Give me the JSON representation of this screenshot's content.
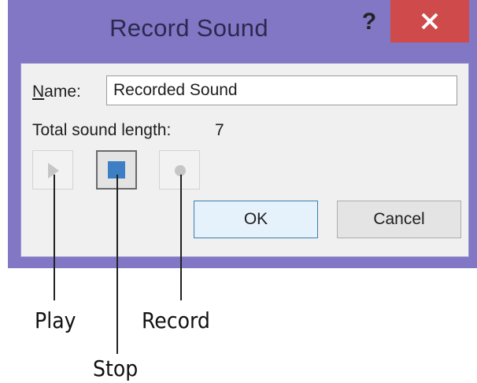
{
  "dialog": {
    "title": "Record Sound",
    "help_label": "?",
    "name_label_accesskey": "N",
    "name_label_rest": "ame:",
    "name_value": "Recorded Sound",
    "length_label": "Total sound length:",
    "length_value": "7",
    "ok_label": "OK",
    "cancel_label": "Cancel"
  },
  "callouts": {
    "play": "Play",
    "stop": "Stop",
    "record": "Record"
  },
  "colors": {
    "window_frame": "#8177c4",
    "close_button": "#cf4a4a",
    "stop_icon": "#3d7ec4",
    "disabled_icon": "#c6c6c6"
  },
  "icons": {
    "play": "play-icon",
    "stop": "stop-icon",
    "record": "record-icon",
    "close": "close-icon",
    "help": "help-icon"
  }
}
